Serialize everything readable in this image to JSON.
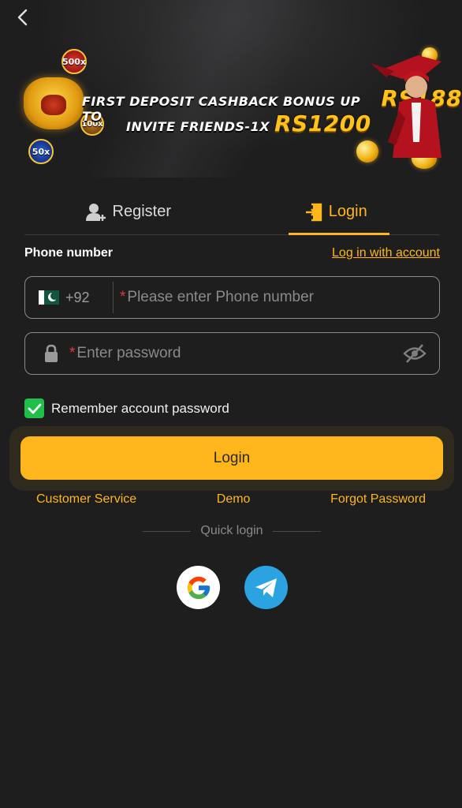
{
  "banner": {
    "line1_text": "FIRST DEPOSIT CASHBACK BONUS UP TO",
    "line1_amount": "RS188",
    "line2_text": "INVITE FRIENDS-1X",
    "line2_amount": "RS1200",
    "badges": [
      "500x",
      "100x",
      "50x"
    ]
  },
  "tabs": [
    {
      "label": "Register",
      "icon": "add-user-icon",
      "active": false
    },
    {
      "label": "Login",
      "icon": "login-door-icon",
      "active": true
    }
  ],
  "form": {
    "phone_label": "Phone number",
    "alt_login_link": "Log in with account",
    "country_code": "+92",
    "country_flag": "pakistan-flag-icon",
    "phone_placeholder": "Please enter Phone number",
    "password_placeholder": "Enter password",
    "required_mark": "*",
    "remember_label": "Remember account password",
    "remember_checked": true,
    "login_button": "Login"
  },
  "links": {
    "customer_service": "Customer Service",
    "demo": "Demo",
    "forgot_password": "Forgot Password"
  },
  "quick_login": {
    "label": "Quick login",
    "providers": [
      "google-icon",
      "telegram-icon"
    ]
  },
  "colors": {
    "accent": "#ffb61c",
    "background": "#1e1e1f",
    "checkbox": "#1fbf4a",
    "telegram": "#2aa3e0",
    "required": "#e23b3b"
  }
}
